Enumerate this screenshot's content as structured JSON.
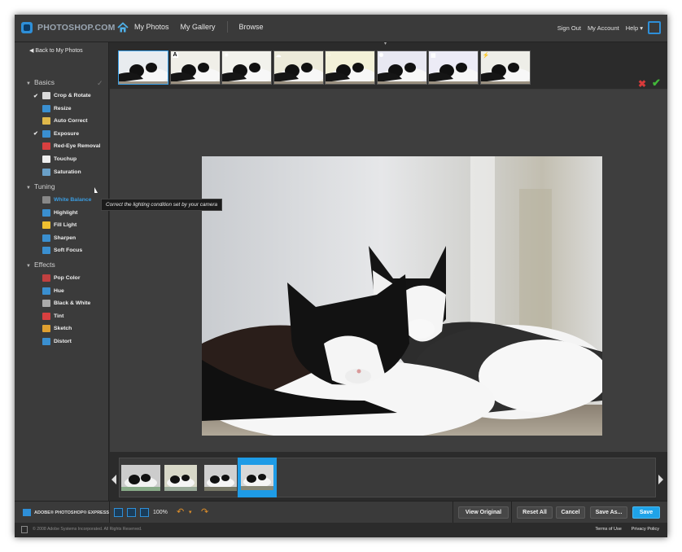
{
  "header": {
    "logo_text": "PHOTOSHOP.COM",
    "nav": [
      "My Photos",
      "My Gallery",
      "Browse"
    ],
    "right_links": [
      "Sign Out",
      "My Account",
      "Help ▾"
    ]
  },
  "sidebar": {
    "back": "Back to My Photos",
    "sections": [
      {
        "title": "Basics",
        "items": [
          {
            "label": "Crop & Rotate",
            "checked": true,
            "icon": "crop-icon",
            "color": "#d9d9d9"
          },
          {
            "label": "Resize",
            "checked": false,
            "icon": "resize-icon",
            "color": "#3a8fd0"
          },
          {
            "label": "Auto Correct",
            "checked": false,
            "icon": "pencil-icon",
            "color": "#e0b84a"
          },
          {
            "label": "Exposure",
            "checked": true,
            "icon": "exposure-icon",
            "color": "#3a8fd0"
          },
          {
            "label": "Red-Eye Removal",
            "checked": false,
            "icon": "eye-icon",
            "color": "#d84040"
          },
          {
            "label": "Touchup",
            "checked": false,
            "icon": "hand-icon",
            "color": "#eeeeee"
          },
          {
            "label": "Saturation",
            "checked": false,
            "icon": "saturation-icon",
            "color": "#6aa0c8"
          }
        ]
      },
      {
        "title": "Tuning",
        "items": [
          {
            "label": "White Balance",
            "checked": false,
            "icon": "white-balance-icon",
            "color": "#888888",
            "active": true
          },
          {
            "label": "Highlight",
            "checked": false,
            "icon": "highlight-icon",
            "color": "#3a8fd0"
          },
          {
            "label": "Fill Light",
            "checked": false,
            "icon": "bulb-icon",
            "color": "#f0c030"
          },
          {
            "label": "Sharpen",
            "checked": false,
            "icon": "sharpen-icon",
            "color": "#3a8fd0"
          },
          {
            "label": "Soft Focus",
            "checked": false,
            "icon": "soft-focus-icon",
            "color": "#3a8fd0"
          }
        ]
      },
      {
        "title": "Effects",
        "items": [
          {
            "label": "Pop Color",
            "checked": false,
            "icon": "brush-icon",
            "color": "#c04040"
          },
          {
            "label": "Hue",
            "checked": false,
            "icon": "hue-icon",
            "color": "#3a8fd0"
          },
          {
            "label": "Black & White",
            "checked": false,
            "icon": "bw-icon",
            "color": "#aaaaaa"
          },
          {
            "label": "Tint",
            "checked": false,
            "icon": "tint-icon",
            "color": "#d84040"
          },
          {
            "label": "Sketch",
            "checked": false,
            "icon": "pencil-icon",
            "color": "#e0a030"
          },
          {
            "label": "Distort",
            "checked": false,
            "icon": "distort-icon",
            "color": "#3a8fd0"
          }
        ]
      }
    ],
    "tooltip": "Correct the lighting condition set by your camera"
  },
  "filmstrip_top": {
    "badges": [
      "",
      "A",
      "☀",
      "☁",
      "⌂",
      "✺",
      "▦",
      "⚡"
    ]
  },
  "bottom_toolbar": {
    "brand": "ADOBE® PHOTOSHOP® EXPRESS",
    "zoom": "100%",
    "buttons": {
      "view_original": "View Original",
      "reset_all": "Reset All",
      "cancel": "Cancel",
      "save_as": "Save As...",
      "save": "Save"
    }
  },
  "footer": {
    "copyright": "© 2008 Adobe Systems Incorporated. All Rights Reserved.",
    "links": [
      "Terms of Use",
      "Privacy Policy"
    ]
  },
  "colors": {
    "accent": "#1fa3e8",
    "background": "#2b2b2b"
  }
}
